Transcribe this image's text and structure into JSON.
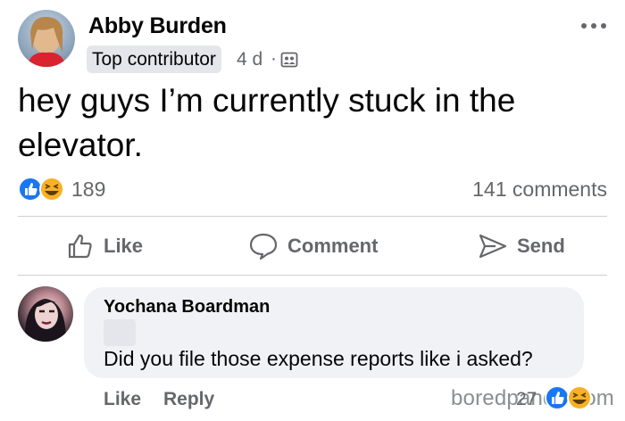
{
  "post": {
    "author": "Abby Burden",
    "badge": "Top contributor",
    "time": "4 d",
    "separator": "·",
    "audience_icon": "group-icon",
    "more_icon": "more-options-icon",
    "text": "hey guys I’m currently stuck in the elevator.",
    "reactions": {
      "icons": [
        "like-icon",
        "haha-icon"
      ],
      "count": "189"
    },
    "comments_count": "141 comments",
    "actions": {
      "like": "Like",
      "comment": "Comment",
      "send": "Send"
    }
  },
  "comment": {
    "author": "Yochana Boardman",
    "text": "Did you file those expense reports like i asked?",
    "actions": {
      "like": "Like",
      "reply": "Reply"
    },
    "reactions": {
      "icons": [
        "like-icon",
        "haha-icon"
      ],
      "count": "27"
    }
  },
  "watermark": "boredpanda.com",
  "colors": {
    "like_blue": "#1877f2",
    "haha_yellow": "#f7b125",
    "secondary_text": "#65676b",
    "bubble_bg": "#f0f2f5",
    "badge_bg": "#e4e6eb"
  }
}
